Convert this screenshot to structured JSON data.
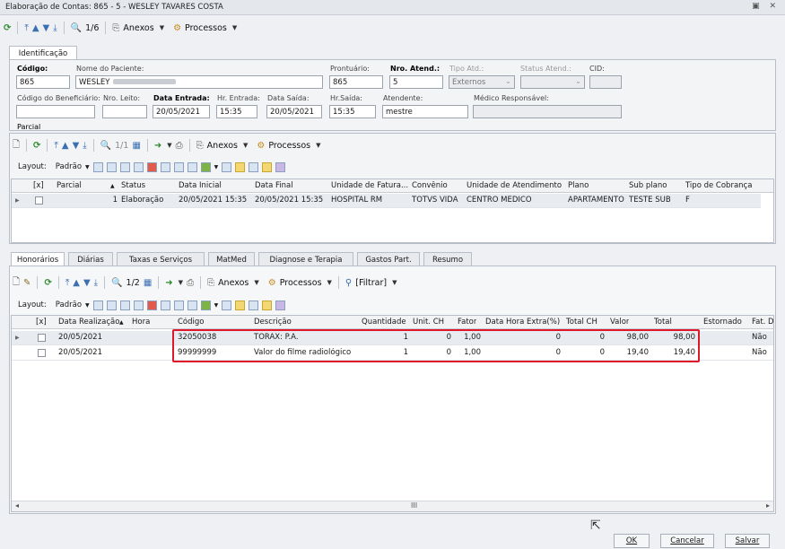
{
  "window": {
    "title": "Elaboração de Contas: 865 - 5 - WESLEY TAVARES COSTA",
    "controls": "▣ ✕"
  },
  "top_toolbar": {
    "record": "1/6",
    "anexos": "Anexos",
    "processos": "Processos"
  },
  "identificacao": {
    "tab": "Identificação",
    "codigo_label": "Código:",
    "codigo": "865",
    "nome_label": "Nome do Paciente:",
    "nome": "WESLEY",
    "prontuario_label": "Prontuário:",
    "prontuario": "865",
    "nro_atend_label": "Nro. Atend.:",
    "nro_atend": "5",
    "tipo_atd_label": "Tipo Atd.:",
    "tipo_atd": "Externos",
    "status_atend_label": "Status Atend.:",
    "cid_label": "CID:",
    "cod_benef_label": "Código do Beneficiário:",
    "nro_leito_label": "Nro. Leito:",
    "data_entrada_label": "Data Entrada:",
    "data_entrada": "20/05/2021",
    "hr_entrada_label": "Hr. Entrada:",
    "hr_entrada": "15:35",
    "data_saida_label": "Data Saída:",
    "data_saida": "20/05/2021",
    "hr_saida_label": "Hr.Saída:",
    "hr_saida": "15:35",
    "atendente_label": "Atendente:",
    "atendente": "mestre",
    "medico_label": "Médico Responsável:"
  },
  "parcial": {
    "section_label": "Parcial",
    "record": "1/1",
    "anexos": "Anexos",
    "processos": "Processos",
    "layout_label": "Layout:",
    "padrao": "Padrão",
    "headers": [
      "[x]",
      "Parcial",
      "Status",
      "Data Inicial",
      "Data Final",
      "Unidade de Fatura...",
      "Convênio",
      "Unidade de Atendimento",
      "Plano",
      "Sub plano",
      "Tipo de Cobrança"
    ],
    "rows": [
      {
        "parcial": "1",
        "status": "Elaboração",
        "data_inicial": "20/05/2021 15:35",
        "data_final": "20/05/2021 15:35",
        "unidade_fatura": "HOSPITAL RM",
        "convenio": "TOTVS VIDA",
        "unidade_atend": "CENTRO MÉDICO",
        "plano": "APARTAMENTO",
        "sub_plano": "TESTE SUB",
        "tipo_cobranca": "F"
      }
    ]
  },
  "tabs": [
    "Honorários",
    "Diárias",
    "Taxas e Serviços",
    "MatMed",
    "Diagnose e Terapia",
    "Gastos Part.",
    "Resumo"
  ],
  "honorarios": {
    "record": "1/2",
    "anexos": "Anexos",
    "processos": "Processos",
    "filtrar": "[Filtrar]",
    "layout_label": "Layout:",
    "padrao": "Padrão",
    "headers": [
      "[x]",
      "Data Realização",
      "Hora",
      "Código",
      "Descrição",
      "Quantidade",
      "Unit. CH",
      "Fator",
      "Data Hora Extra(%)",
      "Total CH",
      "Valor",
      "Total",
      "Estornado",
      "Fat. D"
    ],
    "rows": [
      {
        "data": "20/05/2021",
        "hora": "",
        "codigo": "32050038",
        "descricao": "TORAX: P.A.",
        "qtd": "1",
        "unit_ch": "0",
        "fator": "1,00",
        "extra": "0",
        "total_ch": "0",
        "valor": "98,00",
        "total": "98,00",
        "estornado": "",
        "fat": "Não"
      },
      {
        "data": "20/05/2021",
        "hora": "",
        "codigo": "99999999",
        "descricao": "Valor do filme radiológico",
        "qtd": "1",
        "unit_ch": "0",
        "fator": "1,00",
        "extra": "0",
        "total_ch": "0",
        "valor": "19,40",
        "total": "19,40",
        "estornado": "",
        "fat": "Não"
      }
    ],
    "scroll_mark": "III"
  },
  "footer": {
    "ok": "OK",
    "cancelar": "Cancelar",
    "salvar": "Salvar"
  }
}
